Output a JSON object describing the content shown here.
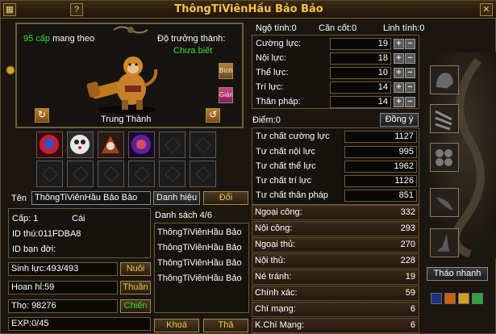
{
  "window": {
    "title": "ThôngTiViênHầu Bảo Bảo",
    "help_label": "?",
    "close_label": "✕"
  },
  "pet": {
    "level_value": "95 cấp",
    "level_suffix": "mang theo",
    "growth_label": "Độ trưởng thành:",
    "growth_value": "Chưa biết",
    "loyalty": "Trung Thành",
    "side_btn_1": "Bình",
    "side_btn_2": "Giám"
  },
  "attributes": {
    "header": [
      {
        "label": "Ngộ tính:",
        "value": "0"
      },
      {
        "label": "Căn cốt:",
        "value": "0"
      },
      {
        "label": "Linh tính:",
        "value": "0"
      }
    ],
    "stats": [
      {
        "label": "Cường lực:",
        "value": "19"
      },
      {
        "label": "Nội lực:",
        "value": "18"
      },
      {
        "label": "Thể lực:",
        "value": "10"
      },
      {
        "label": "Trí lực:",
        "value": "14"
      },
      {
        "label": "Thân pháp:",
        "value": "14"
      }
    ],
    "points_label": "Điểm:0",
    "confirm_label": "Đồng ý"
  },
  "aptitudes": [
    {
      "label": "Tư chất cường lực",
      "value": "1127"
    },
    {
      "label": "Tư chất nội lực",
      "value": "995"
    },
    {
      "label": "Tư chất thể lực",
      "value": "1962"
    },
    {
      "label": "Tư chất trí lực",
      "value": "1126"
    },
    {
      "label": "Tư chất thân pháp",
      "value": "851"
    }
  ],
  "secondary": [
    {
      "label": "Ngoại công:",
      "value": "332"
    },
    {
      "label": "Nội công:",
      "value": "293"
    },
    {
      "label": "Ngoại thủ:",
      "value": "270"
    },
    {
      "label": "Nội thủ:",
      "value": "228"
    },
    {
      "label": "Né tránh:",
      "value": "19"
    },
    {
      "label": "Chính xác:",
      "value": "59"
    },
    {
      "label": "Chí mạng:",
      "value": "6"
    },
    {
      "label": "K.Chí Mạng:",
      "value": "6"
    }
  ],
  "name_row": {
    "label": "Tên",
    "value": "ThôngTiViênHầu Bảo Bảo",
    "title_btn": "Danh hiệu",
    "rename_btn": "Đổi"
  },
  "info": {
    "level": "Cấp: 1",
    "gender": "Cái",
    "id": "ID thú:011FDBA8",
    "partner": "ID bạn đời:",
    "hp": "Sinh lực:493/493",
    "joy": "Hoan hỉ:59",
    "lifespan": "Thọ: 98276",
    "exp": "EXP:0/45",
    "feed_btn": "Nuôi",
    "tame_btn": "Thuần",
    "fight_btn": "Chiến"
  },
  "list": {
    "header": "Danh sách 4/6",
    "items": [
      "ThôngTiViênHầu Bảo",
      "ThôngTiViênHầu Bảo",
      "ThôngTiViênHầu Bảo",
      "ThôngTiViênHầu Bảo"
    ],
    "lock_btn": "Khoá",
    "release_btn": "Thả"
  },
  "equipment": {
    "unequip_btn": "Tháo nhanh"
  },
  "colors": {
    "accent": "#f3c24a",
    "green": "#37e037",
    "frame": "#6a5a3a"
  }
}
